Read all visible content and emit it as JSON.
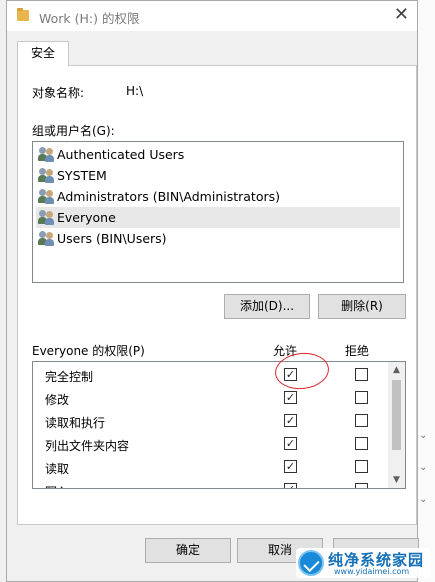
{
  "window": {
    "title": "Work (H:) 的权限",
    "close": "✕"
  },
  "tabs": [
    {
      "label": "安全"
    }
  ],
  "object": {
    "label": "对象名称:",
    "value": "H:\\"
  },
  "groups": {
    "label": "组或用户名(G):",
    "items": [
      {
        "name": "Authenticated Users"
      },
      {
        "name": "SYSTEM"
      },
      {
        "name": "Administrators (BIN\\Administrators)"
      },
      {
        "name": "Everyone"
      },
      {
        "name": "Users (BIN\\Users)"
      }
    ],
    "selected": "Everyone"
  },
  "group_buttons": {
    "add": "添加(D)...",
    "remove": "删除(R)"
  },
  "permissions": {
    "label": "Everyone 的权限(P)",
    "allow_header": "允许",
    "deny_header": "拒绝",
    "rows": [
      {
        "name": "完全控制",
        "allow": true,
        "deny": false
      },
      {
        "name": "修改",
        "allow": true,
        "deny": false
      },
      {
        "name": "读取和执行",
        "allow": true,
        "deny": false
      },
      {
        "name": "列出文件夹内容",
        "allow": true,
        "deny": false
      },
      {
        "name": "读取",
        "allow": true,
        "deny": false
      },
      {
        "name": "写入",
        "allow": true,
        "deny": false
      }
    ]
  },
  "footer": {
    "ok": "确定",
    "cancel": "取消",
    "apply": ""
  },
  "watermark": {
    "main": "纯净系统家园",
    "url": "www.yidaimei.com"
  },
  "colors": {
    "annotation": "#d9262b",
    "selected_row": "#e8e8e8",
    "dialog_bg": "#f0f0f0"
  }
}
